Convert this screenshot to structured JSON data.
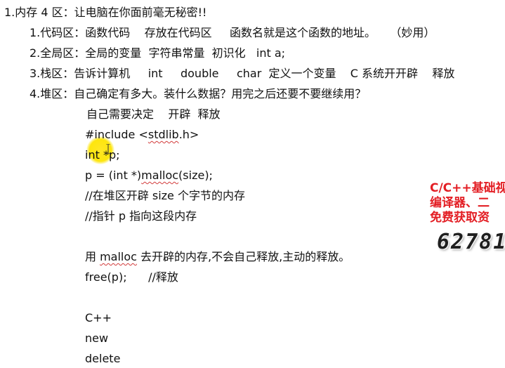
{
  "heading": "1.内存 4 区：让电脑在你面前毫无秘密!!",
  "sections": {
    "code": "1.代码区：函数代码    存放在代码区     函数名就是这个函数的地址。    （妙用）",
    "global": "2.全局区：全局的变量  字符串常量  初识化   int a;",
    "stack": "3.栈区：告诉计算机     int     double     char  定义一个变量    C 系统开开辟    释放",
    "heap": "4.堆区：自己确定有多大。装什么数据？用完之后还要不要继续用？"
  },
  "heap_notes": {
    "decide": "自己需要决定    开辟  释放",
    "include_prefix": "#include <",
    "include_lib": "stdlib",
    "include_suffix": ".h>",
    "decl": "int *p;",
    "malloc_prefix": "p = (int *)",
    "malloc_word": "malloc",
    "malloc_suffix": "(size);",
    "comment1": "//在堆区开辟 size 个字节的内存",
    "comment2": "//指针 p 指向这段内存",
    "use_prefix": "用 ",
    "use_word": "malloc",
    "use_suffix": " 去开辟的内存,不会自己释放,主动的释放。",
    "free": "free(p);      //释放"
  },
  "cpp": {
    "title": "C++",
    "new": "new",
    "delete": "delete"
  },
  "promo": {
    "line1": "C/C++基础视",
    "line2": "编译器、二",
    "line3": "免费获取资",
    "number": "62781"
  },
  "colors": {
    "promo_red": "#e31e24",
    "highlight_yellow": "#fde400",
    "squiggle_red": "#d23b3b"
  }
}
